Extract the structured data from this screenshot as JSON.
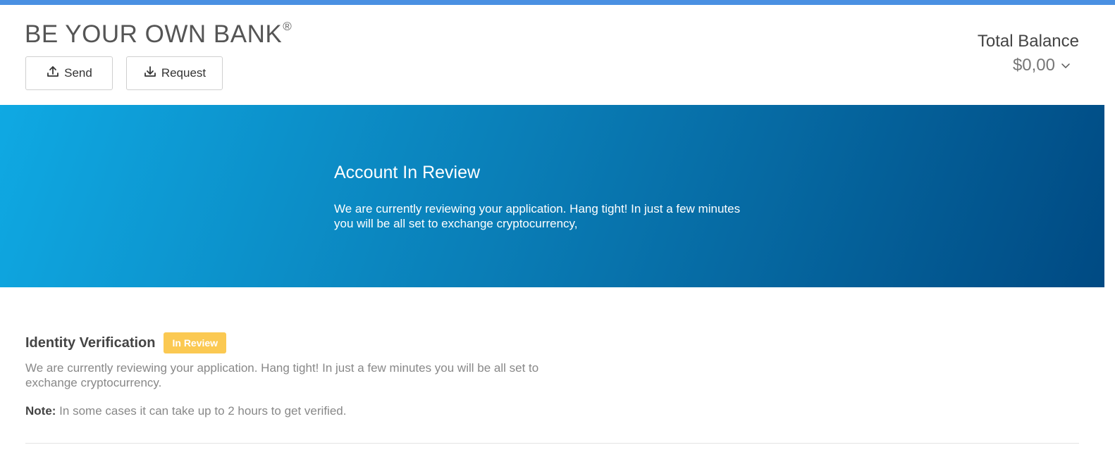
{
  "header": {
    "brand": "BE YOUR OWN BANK",
    "brand_mark": "®",
    "send_label": "Send",
    "request_label": "Request",
    "balance_title": "Total Balance",
    "balance_amount": "$0,00"
  },
  "banner": {
    "title": "Account In Review",
    "text": "We are currently reviewing your application. Hang tight! In just a few minutes you will be all set to exchange cryptocurrency,"
  },
  "verification": {
    "title": "Identity Verification",
    "badge": "In Review",
    "description": "We are currently reviewing your application. Hang tight! In just a few minutes you will be all set to exchange cryptocurrency.",
    "note_label": "Note:",
    "note_text": " In some cases it can take up to 2 hours to get verified."
  },
  "icons": {
    "send": "upload-icon",
    "request": "download-icon",
    "balance_toggle": "chevron-down-icon"
  },
  "colors": {
    "topbar": "#4a90e2",
    "banner_start": "#0fa9e3",
    "banner_end": "#004a83",
    "badge": "#fbc952"
  }
}
